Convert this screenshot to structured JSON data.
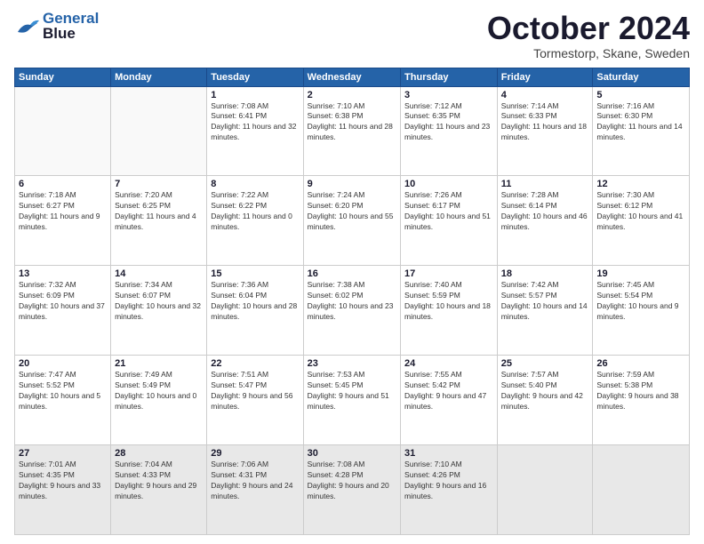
{
  "logo": {
    "line1": "General",
    "line2": "Blue"
  },
  "title": "October 2024",
  "location": "Tormestorp, Skane, Sweden",
  "weekdays": [
    "Sunday",
    "Monday",
    "Tuesday",
    "Wednesday",
    "Thursday",
    "Friday",
    "Saturday"
  ],
  "weeks": [
    [
      {
        "day": "",
        "sunrise": "",
        "sunset": "",
        "daylight": ""
      },
      {
        "day": "",
        "sunrise": "",
        "sunset": "",
        "daylight": ""
      },
      {
        "day": "1",
        "sunrise": "Sunrise: 7:08 AM",
        "sunset": "Sunset: 6:41 PM",
        "daylight": "Daylight: 11 hours and 32 minutes."
      },
      {
        "day": "2",
        "sunrise": "Sunrise: 7:10 AM",
        "sunset": "Sunset: 6:38 PM",
        "daylight": "Daylight: 11 hours and 28 minutes."
      },
      {
        "day": "3",
        "sunrise": "Sunrise: 7:12 AM",
        "sunset": "Sunset: 6:35 PM",
        "daylight": "Daylight: 11 hours and 23 minutes."
      },
      {
        "day": "4",
        "sunrise": "Sunrise: 7:14 AM",
        "sunset": "Sunset: 6:33 PM",
        "daylight": "Daylight: 11 hours and 18 minutes."
      },
      {
        "day": "5",
        "sunrise": "Sunrise: 7:16 AM",
        "sunset": "Sunset: 6:30 PM",
        "daylight": "Daylight: 11 hours and 14 minutes."
      }
    ],
    [
      {
        "day": "6",
        "sunrise": "Sunrise: 7:18 AM",
        "sunset": "Sunset: 6:27 PM",
        "daylight": "Daylight: 11 hours and 9 minutes."
      },
      {
        "day": "7",
        "sunrise": "Sunrise: 7:20 AM",
        "sunset": "Sunset: 6:25 PM",
        "daylight": "Daylight: 11 hours and 4 minutes."
      },
      {
        "day": "8",
        "sunrise": "Sunrise: 7:22 AM",
        "sunset": "Sunset: 6:22 PM",
        "daylight": "Daylight: 11 hours and 0 minutes."
      },
      {
        "day": "9",
        "sunrise": "Sunrise: 7:24 AM",
        "sunset": "Sunset: 6:20 PM",
        "daylight": "Daylight: 10 hours and 55 minutes."
      },
      {
        "day": "10",
        "sunrise": "Sunrise: 7:26 AM",
        "sunset": "Sunset: 6:17 PM",
        "daylight": "Daylight: 10 hours and 51 minutes."
      },
      {
        "day": "11",
        "sunrise": "Sunrise: 7:28 AM",
        "sunset": "Sunset: 6:14 PM",
        "daylight": "Daylight: 10 hours and 46 minutes."
      },
      {
        "day": "12",
        "sunrise": "Sunrise: 7:30 AM",
        "sunset": "Sunset: 6:12 PM",
        "daylight": "Daylight: 10 hours and 41 minutes."
      }
    ],
    [
      {
        "day": "13",
        "sunrise": "Sunrise: 7:32 AM",
        "sunset": "Sunset: 6:09 PM",
        "daylight": "Daylight: 10 hours and 37 minutes."
      },
      {
        "day": "14",
        "sunrise": "Sunrise: 7:34 AM",
        "sunset": "Sunset: 6:07 PM",
        "daylight": "Daylight: 10 hours and 32 minutes."
      },
      {
        "day": "15",
        "sunrise": "Sunrise: 7:36 AM",
        "sunset": "Sunset: 6:04 PM",
        "daylight": "Daylight: 10 hours and 28 minutes."
      },
      {
        "day": "16",
        "sunrise": "Sunrise: 7:38 AM",
        "sunset": "Sunset: 6:02 PM",
        "daylight": "Daylight: 10 hours and 23 minutes."
      },
      {
        "day": "17",
        "sunrise": "Sunrise: 7:40 AM",
        "sunset": "Sunset: 5:59 PM",
        "daylight": "Daylight: 10 hours and 18 minutes."
      },
      {
        "day": "18",
        "sunrise": "Sunrise: 7:42 AM",
        "sunset": "Sunset: 5:57 PM",
        "daylight": "Daylight: 10 hours and 14 minutes."
      },
      {
        "day": "19",
        "sunrise": "Sunrise: 7:45 AM",
        "sunset": "Sunset: 5:54 PM",
        "daylight": "Daylight: 10 hours and 9 minutes."
      }
    ],
    [
      {
        "day": "20",
        "sunrise": "Sunrise: 7:47 AM",
        "sunset": "Sunset: 5:52 PM",
        "daylight": "Daylight: 10 hours and 5 minutes."
      },
      {
        "day": "21",
        "sunrise": "Sunrise: 7:49 AM",
        "sunset": "Sunset: 5:49 PM",
        "daylight": "Daylight: 10 hours and 0 minutes."
      },
      {
        "day": "22",
        "sunrise": "Sunrise: 7:51 AM",
        "sunset": "Sunset: 5:47 PM",
        "daylight": "Daylight: 9 hours and 56 minutes."
      },
      {
        "day": "23",
        "sunrise": "Sunrise: 7:53 AM",
        "sunset": "Sunset: 5:45 PM",
        "daylight": "Daylight: 9 hours and 51 minutes."
      },
      {
        "day": "24",
        "sunrise": "Sunrise: 7:55 AM",
        "sunset": "Sunset: 5:42 PM",
        "daylight": "Daylight: 9 hours and 47 minutes."
      },
      {
        "day": "25",
        "sunrise": "Sunrise: 7:57 AM",
        "sunset": "Sunset: 5:40 PM",
        "daylight": "Daylight: 9 hours and 42 minutes."
      },
      {
        "day": "26",
        "sunrise": "Sunrise: 7:59 AM",
        "sunset": "Sunset: 5:38 PM",
        "daylight": "Daylight: 9 hours and 38 minutes."
      }
    ],
    [
      {
        "day": "27",
        "sunrise": "Sunrise: 7:01 AM",
        "sunset": "Sunset: 4:35 PM",
        "daylight": "Daylight: 9 hours and 33 minutes."
      },
      {
        "day": "28",
        "sunrise": "Sunrise: 7:04 AM",
        "sunset": "Sunset: 4:33 PM",
        "daylight": "Daylight: 9 hours and 29 minutes."
      },
      {
        "day": "29",
        "sunrise": "Sunrise: 7:06 AM",
        "sunset": "Sunset: 4:31 PM",
        "daylight": "Daylight: 9 hours and 24 minutes."
      },
      {
        "day": "30",
        "sunrise": "Sunrise: 7:08 AM",
        "sunset": "Sunset: 4:28 PM",
        "daylight": "Daylight: 9 hours and 20 minutes."
      },
      {
        "day": "31",
        "sunrise": "Sunrise: 7:10 AM",
        "sunset": "Sunset: 4:26 PM",
        "daylight": "Daylight: 9 hours and 16 minutes."
      },
      {
        "day": "",
        "sunrise": "",
        "sunset": "",
        "daylight": ""
      },
      {
        "day": "",
        "sunrise": "",
        "sunset": "",
        "daylight": ""
      }
    ]
  ]
}
